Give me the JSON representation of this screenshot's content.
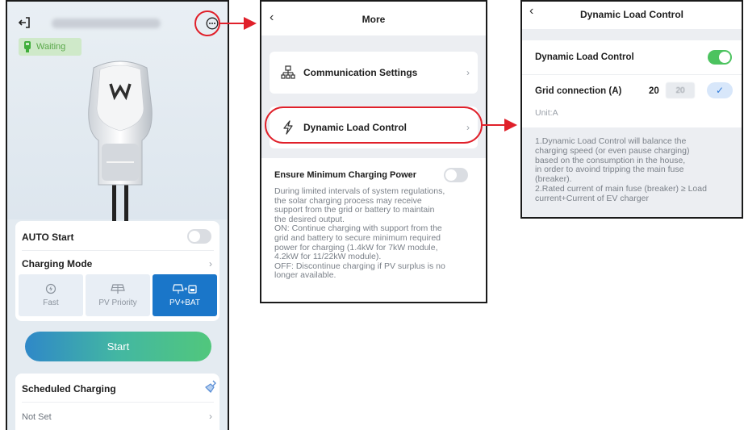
{
  "panel_home": {
    "status_badge": "Waiting",
    "auto_start": {
      "label": "AUTO Start",
      "enabled": false
    },
    "charging_mode": {
      "label": "Charging Mode",
      "modes": [
        {
          "label": "Fast",
          "icon": "fast-charge-icon",
          "active": false
        },
        {
          "label": "PV Priority",
          "icon": "solar-panel-icon",
          "active": false
        },
        {
          "label": "PV+BAT",
          "icon": "solar-battery-icon",
          "active": true
        }
      ]
    },
    "start_label": "Start",
    "scheduled": {
      "label": "Scheduled Charging",
      "value": "Not Set"
    }
  },
  "panel_more": {
    "title": "More",
    "items": [
      {
        "label": "Communication Settings",
        "icon": "network-icon"
      },
      {
        "label": "Dynamic Load Control",
        "icon": "lightning-icon"
      }
    ],
    "min_power": {
      "label": "Ensure Minimum Charging Power",
      "enabled": false,
      "description": "During limited intervals of system regulations,\nthe solar charging process may receive\nsupport from the grid or battery to maintain\nthe desired output.\nON: Continue charging with support from the\ngrid and battery to secure minimum required\npower for charging (1.4kW for 7kW module,\n4.2kW for 11/22kW module).\nOFF:  Discontinue charging if PV surplus is no\nlonger available."
    }
  },
  "panel_dlc": {
    "title": "Dynamic Load Control",
    "toggle_label": "Dynamic Load Control",
    "enabled": true,
    "grid_label": "Grid connection (A)",
    "grid_value": "20",
    "grid_input": "20",
    "unit": "Unit:A",
    "description": "1.Dynamic Load Control will balance the\ncharging speed (or even pause charging)\nbased on the consumption in the house,\nin order to avoind tripping the main fuse\n(breaker).\n2.Rated current of main fuse (breaker) ≥ Load\ncurrent+Current of EV charger"
  },
  "colors": {
    "accent": "#1a76c9",
    "toggle_on": "#4cc35f",
    "highlight": "#e0202a"
  }
}
